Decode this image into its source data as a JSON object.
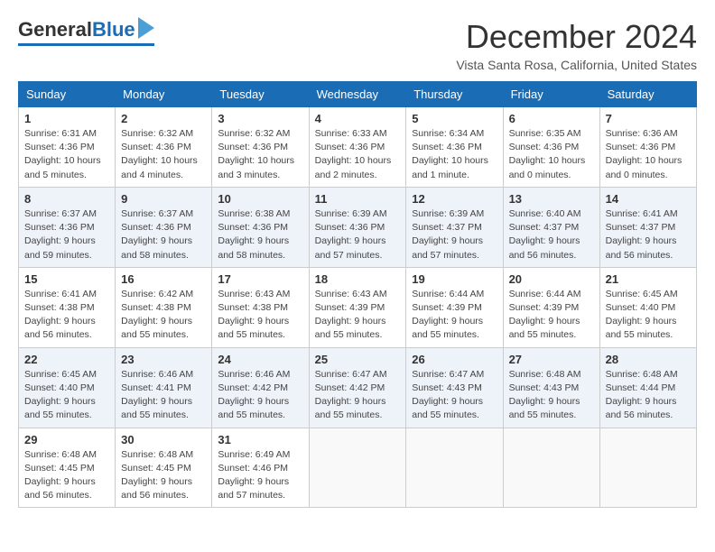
{
  "logo": {
    "general": "General",
    "blue": "Blue"
  },
  "title": "December 2024",
  "location": "Vista Santa Rosa, California, United States",
  "days_of_week": [
    "Sunday",
    "Monday",
    "Tuesday",
    "Wednesday",
    "Thursday",
    "Friday",
    "Saturday"
  ],
  "weeks": [
    [
      {
        "day": "1",
        "info": "Sunrise: 6:31 AM\nSunset: 4:36 PM\nDaylight: 10 hours\nand 5 minutes."
      },
      {
        "day": "2",
        "info": "Sunrise: 6:32 AM\nSunset: 4:36 PM\nDaylight: 10 hours\nand 4 minutes."
      },
      {
        "day": "3",
        "info": "Sunrise: 6:32 AM\nSunset: 4:36 PM\nDaylight: 10 hours\nand 3 minutes."
      },
      {
        "day": "4",
        "info": "Sunrise: 6:33 AM\nSunset: 4:36 PM\nDaylight: 10 hours\nand 2 minutes."
      },
      {
        "day": "5",
        "info": "Sunrise: 6:34 AM\nSunset: 4:36 PM\nDaylight: 10 hours\nand 1 minute."
      },
      {
        "day": "6",
        "info": "Sunrise: 6:35 AM\nSunset: 4:36 PM\nDaylight: 10 hours\nand 0 minutes."
      },
      {
        "day": "7",
        "info": "Sunrise: 6:36 AM\nSunset: 4:36 PM\nDaylight: 10 hours\nand 0 minutes."
      }
    ],
    [
      {
        "day": "8",
        "info": "Sunrise: 6:37 AM\nSunset: 4:36 PM\nDaylight: 9 hours\nand 59 minutes."
      },
      {
        "day": "9",
        "info": "Sunrise: 6:37 AM\nSunset: 4:36 PM\nDaylight: 9 hours\nand 58 minutes."
      },
      {
        "day": "10",
        "info": "Sunrise: 6:38 AM\nSunset: 4:36 PM\nDaylight: 9 hours\nand 58 minutes."
      },
      {
        "day": "11",
        "info": "Sunrise: 6:39 AM\nSunset: 4:36 PM\nDaylight: 9 hours\nand 57 minutes."
      },
      {
        "day": "12",
        "info": "Sunrise: 6:39 AM\nSunset: 4:37 PM\nDaylight: 9 hours\nand 57 minutes."
      },
      {
        "day": "13",
        "info": "Sunrise: 6:40 AM\nSunset: 4:37 PM\nDaylight: 9 hours\nand 56 minutes."
      },
      {
        "day": "14",
        "info": "Sunrise: 6:41 AM\nSunset: 4:37 PM\nDaylight: 9 hours\nand 56 minutes."
      }
    ],
    [
      {
        "day": "15",
        "info": "Sunrise: 6:41 AM\nSunset: 4:38 PM\nDaylight: 9 hours\nand 56 minutes."
      },
      {
        "day": "16",
        "info": "Sunrise: 6:42 AM\nSunset: 4:38 PM\nDaylight: 9 hours\nand 55 minutes."
      },
      {
        "day": "17",
        "info": "Sunrise: 6:43 AM\nSunset: 4:38 PM\nDaylight: 9 hours\nand 55 minutes."
      },
      {
        "day": "18",
        "info": "Sunrise: 6:43 AM\nSunset: 4:39 PM\nDaylight: 9 hours\nand 55 minutes."
      },
      {
        "day": "19",
        "info": "Sunrise: 6:44 AM\nSunset: 4:39 PM\nDaylight: 9 hours\nand 55 minutes."
      },
      {
        "day": "20",
        "info": "Sunrise: 6:44 AM\nSunset: 4:39 PM\nDaylight: 9 hours\nand 55 minutes."
      },
      {
        "day": "21",
        "info": "Sunrise: 6:45 AM\nSunset: 4:40 PM\nDaylight: 9 hours\nand 55 minutes."
      }
    ],
    [
      {
        "day": "22",
        "info": "Sunrise: 6:45 AM\nSunset: 4:40 PM\nDaylight: 9 hours\nand 55 minutes."
      },
      {
        "day": "23",
        "info": "Sunrise: 6:46 AM\nSunset: 4:41 PM\nDaylight: 9 hours\nand 55 minutes."
      },
      {
        "day": "24",
        "info": "Sunrise: 6:46 AM\nSunset: 4:42 PM\nDaylight: 9 hours\nand 55 minutes."
      },
      {
        "day": "25",
        "info": "Sunrise: 6:47 AM\nSunset: 4:42 PM\nDaylight: 9 hours\nand 55 minutes."
      },
      {
        "day": "26",
        "info": "Sunrise: 6:47 AM\nSunset: 4:43 PM\nDaylight: 9 hours\nand 55 minutes."
      },
      {
        "day": "27",
        "info": "Sunrise: 6:48 AM\nSunset: 4:43 PM\nDaylight: 9 hours\nand 55 minutes."
      },
      {
        "day": "28",
        "info": "Sunrise: 6:48 AM\nSunset: 4:44 PM\nDaylight: 9 hours\nand 56 minutes."
      }
    ],
    [
      {
        "day": "29",
        "info": "Sunrise: 6:48 AM\nSunset: 4:45 PM\nDaylight: 9 hours\nand 56 minutes."
      },
      {
        "day": "30",
        "info": "Sunrise: 6:48 AM\nSunset: 4:45 PM\nDaylight: 9 hours\nand 56 minutes."
      },
      {
        "day": "31",
        "info": "Sunrise: 6:49 AM\nSunset: 4:46 PM\nDaylight: 9 hours\nand 57 minutes."
      },
      {
        "day": "",
        "info": ""
      },
      {
        "day": "",
        "info": ""
      },
      {
        "day": "",
        "info": ""
      },
      {
        "day": "",
        "info": ""
      }
    ]
  ]
}
